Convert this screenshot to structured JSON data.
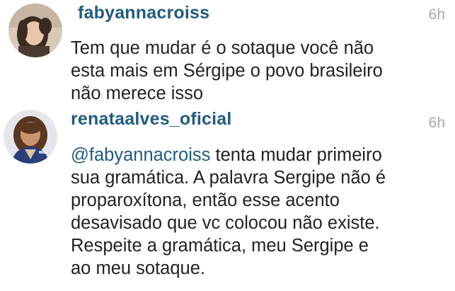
{
  "comments": [
    {
      "username": "fabyannacroiss",
      "time": "6h",
      "avatar_icon": "user-avatar-photo",
      "lines": [
        "Tem que mudar é o sotaque você não",
        "esta mais em Sérgipe o povo brasileiro",
        "não merece isso"
      ]
    },
    {
      "username": "renataalves_oficial",
      "time": "6h",
      "avatar_icon": "user-avatar-photo",
      "mention": "@fabyannacroiss",
      "first_line_rest": " tenta mudar primeiro",
      "lines": [
        "sua gramática. A palavra Sergipe não é",
        "proparoxítona, então esse acento",
        "desavisado que vc colocou não existe.",
        "Respeite a gramática, meu Sergipe e",
        "ao meu sotaque."
      ]
    }
  ],
  "colors": {
    "username": "#235b7d",
    "mention": "#235b7d",
    "text": "#222222",
    "timestamp": "#a9a9a9",
    "background": "#ffffff"
  }
}
